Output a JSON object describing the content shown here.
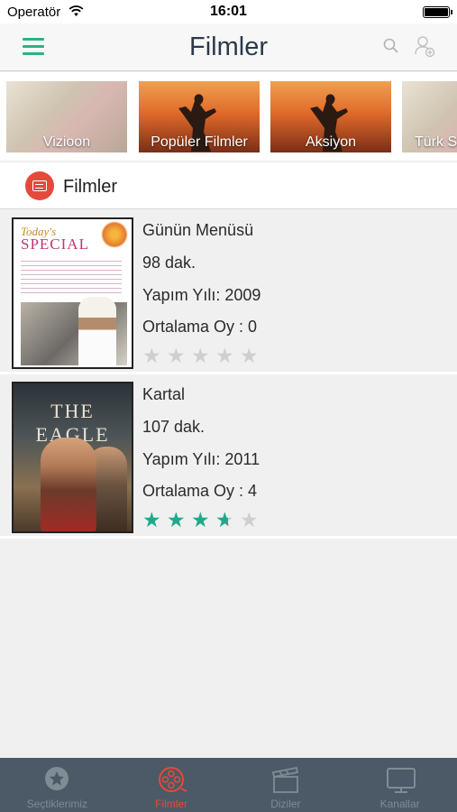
{
  "status_bar": {
    "carrier": "Operatör",
    "time": "16:01"
  },
  "nav": {
    "title": "Filmler",
    "menu_icon": "hamburger-icon",
    "search_icon": "search-icon",
    "user_icon": "user-add-icon",
    "accent": "#2eb18a"
  },
  "categories": [
    {
      "label": "Vizioon"
    },
    {
      "label": "Popüler Filmler"
    },
    {
      "label": "Aksiyon"
    },
    {
      "label": "Türk Sinema"
    }
  ],
  "section": {
    "title": "Filmler",
    "icon": "film-icon",
    "badge_color": "#e44a3c"
  },
  "movies": [
    {
      "title": "Günün Menüsü",
      "duration": "98 dak.",
      "year": "Yapım Yılı: 2009",
      "rating_text": "Ortalama Oy : 0",
      "rating": 0
    },
    {
      "title": "Kartal",
      "duration": "107 dak.",
      "year": "Yapım Yılı: 2011",
      "rating_text": "Ortalama Oy : 4",
      "rating": 3.5
    }
  ],
  "poster_texts": {
    "special_top": "Today's",
    "special_main": "SPECIAL",
    "eagle_main": "THE EAGLE"
  },
  "tabs": [
    {
      "label": "Seçtiklerimiz",
      "icon": "star-circle-icon",
      "active": false
    },
    {
      "label": "Filmler",
      "icon": "film-reel-icon",
      "active": true
    },
    {
      "label": "Diziler",
      "icon": "clapperboard-icon",
      "active": false
    },
    {
      "label": "Kanallar",
      "icon": "tv-icon",
      "active": false
    }
  ],
  "colors": {
    "tab_active": "#e44a3c",
    "tab_inactive": "#7f8c96",
    "tabbar_bg": "#4b5a66",
    "star_on": "#1fa98a",
    "star_off": "#cfcfcf"
  }
}
